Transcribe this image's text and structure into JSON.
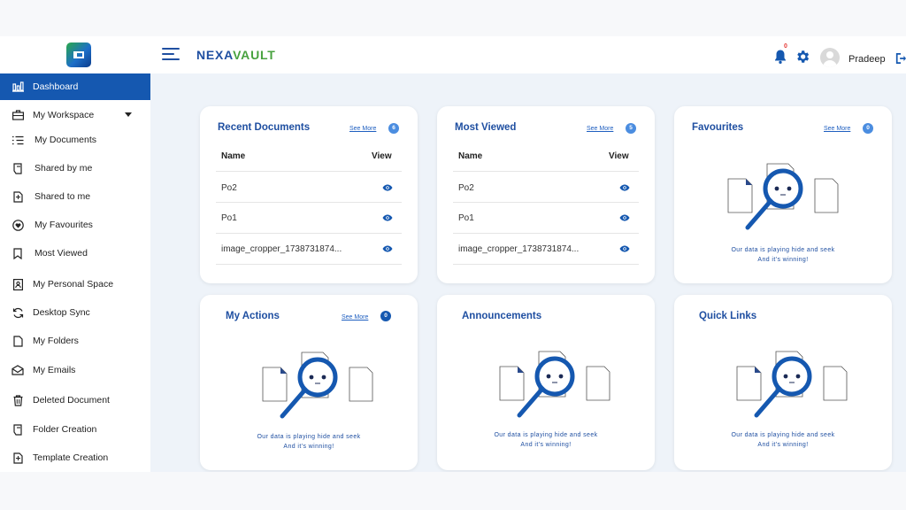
{
  "header": {
    "brand_part1": "NEXA",
    "brand_part2": "VAULT",
    "notification_count": "0",
    "user_name": "Pradeep"
  },
  "sidebar": {
    "items": [
      {
        "label": "Dashboard",
        "icon": "bar-chart-icon",
        "active": true
      },
      {
        "label": "My Workspace",
        "icon": "briefcase-icon",
        "expanded": true
      },
      {
        "label": "My Documents",
        "icon": "list-icon"
      },
      {
        "label": "Shared by me",
        "icon": "share-out-icon"
      },
      {
        "label": "Shared to me",
        "icon": "share-in-icon"
      },
      {
        "label": "My Favourites",
        "icon": "heart-icon"
      },
      {
        "label": "Most Viewed",
        "icon": "bookmark-icon"
      },
      {
        "label": "My Personal Space",
        "icon": "personal-icon"
      },
      {
        "label": "Desktop Sync",
        "icon": "sync-icon"
      },
      {
        "label": "My Folders",
        "icon": "folder-icon"
      },
      {
        "label": "My Emails",
        "icon": "email-icon"
      },
      {
        "label": "Deleted Document",
        "icon": "trash-icon"
      },
      {
        "label": "Folder Creation",
        "icon": "folder-create-icon"
      },
      {
        "label": "Template Creation",
        "icon": "template-icon"
      }
    ]
  },
  "cards": {
    "recent": {
      "title": "Recent Documents",
      "see_more": "See More",
      "count": "6",
      "col_name": "Name",
      "col_view": "View",
      "rows": [
        "Po2",
        "Po1",
        "image_cropper_1738731874..."
      ]
    },
    "most_viewed": {
      "title": "Most Viewed",
      "see_more": "See More",
      "count": "5",
      "col_name": "Name",
      "col_view": "View",
      "rows": [
        "Po2",
        "Po1",
        "image_cropper_1738731874..."
      ]
    },
    "favourites": {
      "title": "Favourites",
      "see_more": "See More",
      "count": "0",
      "empty_line1": "Our data is playing hide and seek",
      "empty_line2": "And it's winning!"
    },
    "actions": {
      "title": "My Actions",
      "see_more": "See More",
      "count": "0",
      "empty_line1": "Our data is playing hide and seek",
      "empty_line2": "And it's winning!"
    },
    "announcements": {
      "title": "Announcements",
      "empty_line1": "Our data is playing hide and seek",
      "empty_line2": "And it's winning!"
    },
    "quick_links": {
      "title": "Quick Links",
      "empty_line1": "Our data is playing hide and seek",
      "empty_line2": "And it's winning!"
    }
  },
  "colors": {
    "primary": "#1f4fa1",
    "active_nav": "#1558b0",
    "brand_green": "#48a23f",
    "badge": "#4b8de0",
    "background": "#eef3f9"
  }
}
